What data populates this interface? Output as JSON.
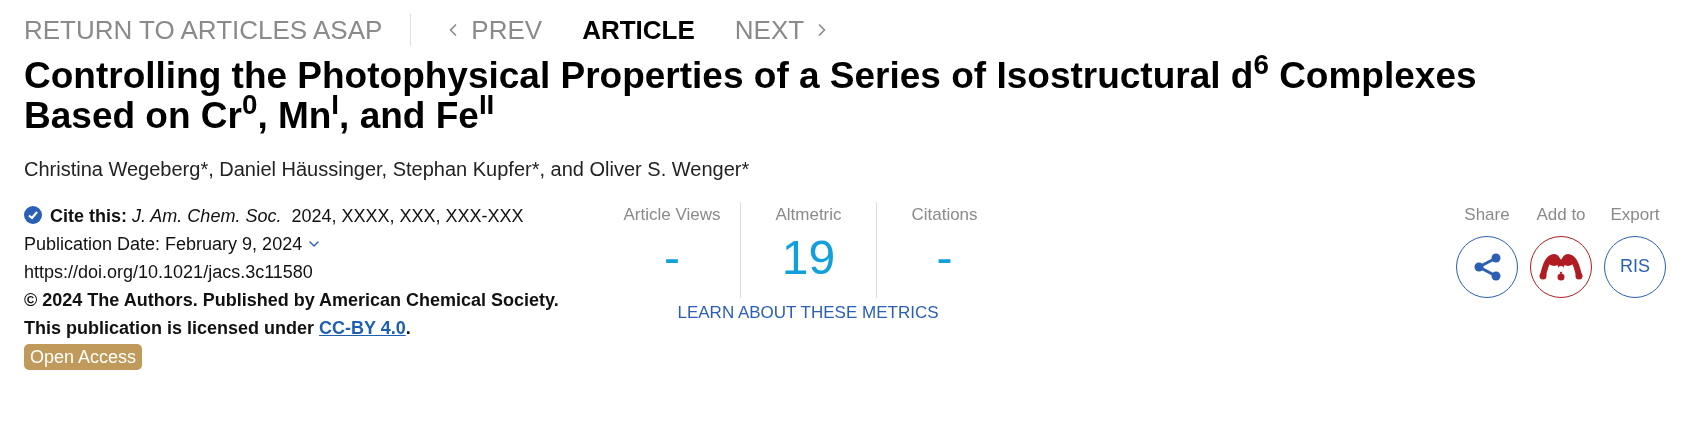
{
  "nav": {
    "back": "RETURN TO ARTICLES ASAP",
    "items": [
      {
        "label": "PREV",
        "kind": "prev",
        "selected": false
      },
      {
        "label": "ARTICLE",
        "kind": "current",
        "selected": true
      },
      {
        "label": "NEXT",
        "kind": "next",
        "selected": false
      }
    ]
  },
  "title": "Controlling the Photophysical Properties of a Series of Isostructural d$^{6}$ Complexes Based on Cr$^{0}$, Mn$^{I}$, and Fe$^{II}$",
  "authors": "Christina Wegeberg*, Daniel Häussinger, Stephan Kupfer*, and Oliver S. Wenger*",
  "citation": {
    "text": "**Cite this:** *J. Am. Chem. Soc.*  2024, XXXX, XXX, XXX-XXX",
    "publication_date": "Publication Date: February 9, 2024",
    "doi": "https://doi.org/10.1021/jacs.3c11580",
    "license_text": "© 2024 The Authors. Published by American Chemical Society. This publication is licensed under",
    "license_link": "CC-BY 4.0",
    "license_end": ".",
    "badge": "Open Access"
  },
  "metrics": {
    "items": [
      {
        "label": "Article Views",
        "value": "-"
      },
      {
        "label": "Altmetric",
        "value": "19"
      },
      {
        "label": "Citations",
        "value": "-"
      }
    ],
    "link": "LEARN ABOUT THESE METRICS"
  },
  "actions": [
    {
      "label": "Share",
      "kind": "share"
    },
    {
      "label": "Add to",
      "kind": "mendeley"
    },
    {
      "label": "Export",
      "kind": "ris",
      "text": "RIS"
    }
  ]
}
